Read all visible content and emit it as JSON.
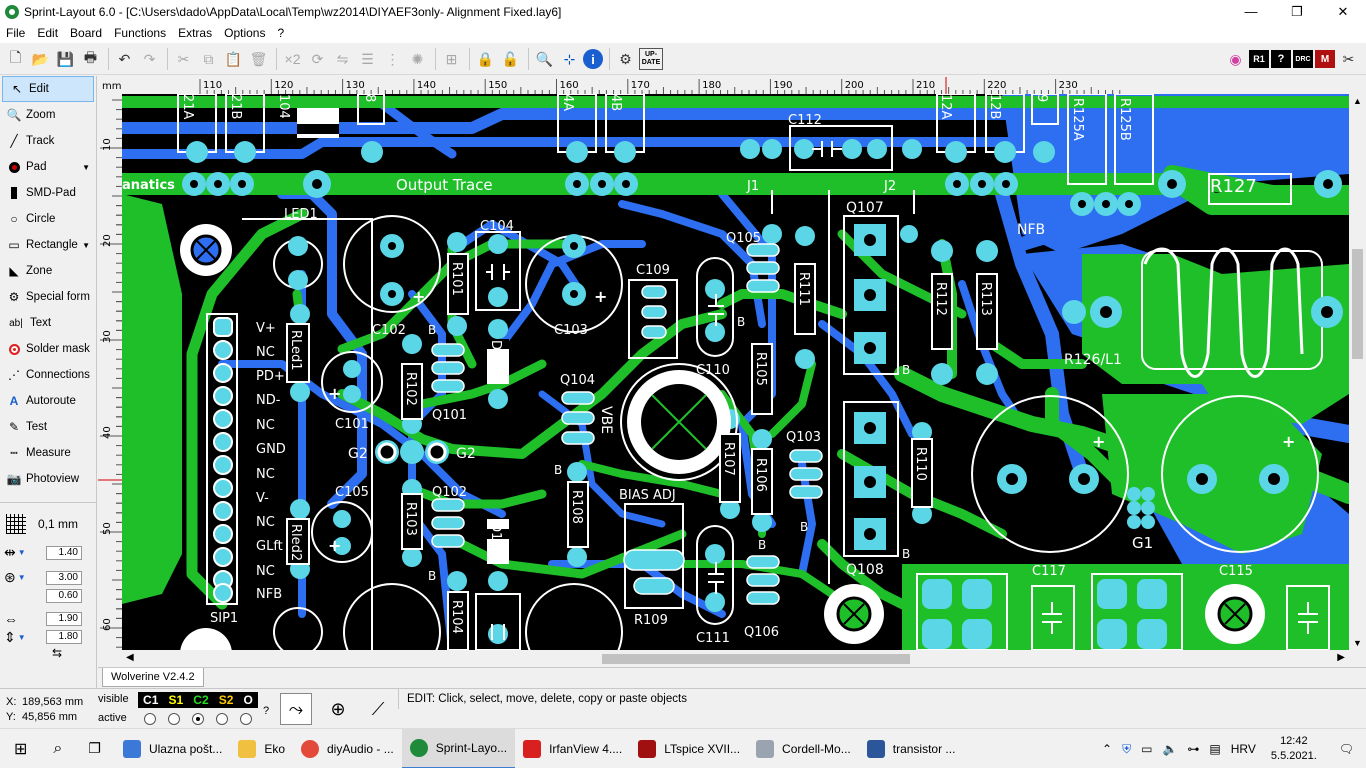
{
  "window": {
    "title": "Sprint-Layout 6.0 - [C:\\Users\\dado\\AppData\\Local\\Temp\\wz2014\\DIYAEF3only- Alignment Fixed.lay6]",
    "minimize": "—",
    "maximize": "❐",
    "close": "✕"
  },
  "menu": [
    "File",
    "Edit",
    "Board",
    "Functions",
    "Extras",
    "Options",
    "?"
  ],
  "toolbar": {
    "x2_label": "×2",
    "update_label": "UP-DATE",
    "r1_label": "R1",
    "drc_label": "DRC",
    "m_label": "M"
  },
  "tools": [
    {
      "label": "Edit",
      "icon": "cursor-arrow-icon"
    },
    {
      "label": "Zoom",
      "icon": "magnifier-icon"
    },
    {
      "label": "Track",
      "icon": "track-icon"
    },
    {
      "label": "Pad",
      "icon": "pad-icon"
    },
    {
      "label": "SMD-Pad",
      "icon": "smd-pad-icon"
    },
    {
      "label": "Circle",
      "icon": "circle-icon"
    },
    {
      "label": "Rectangle",
      "icon": "rectangle-icon"
    },
    {
      "label": "Zone",
      "icon": "zone-icon"
    },
    {
      "label": "Special form",
      "icon": "special-form-icon"
    },
    {
      "label": "Text",
      "icon": "text-tool-icon"
    },
    {
      "label": "Solder mask",
      "icon": "solder-mask-icon"
    },
    {
      "label": "Connections",
      "icon": "connections-icon"
    },
    {
      "label": "Autoroute",
      "icon": "autoroute-icon"
    },
    {
      "label": "Test",
      "icon": "test-icon"
    },
    {
      "label": "Measure",
      "icon": "measure-icon"
    },
    {
      "label": "Photoview",
      "icon": "photoview-icon"
    }
  ],
  "grid": {
    "value": "0,1 mm"
  },
  "params": {
    "track_width": "1.40",
    "pad_outer": "3.00",
    "pad_inner": "0.60",
    "smd_w": "1.90",
    "smd_h": "1.80"
  },
  "ruler": {
    "unit": "mm",
    "top_labels": [
      "110",
      "120",
      "130",
      "140",
      "150",
      "160",
      "170",
      "180",
      "190",
      "200",
      "210",
      "220",
      "230"
    ],
    "left_labels": [
      "10",
      "20",
      "30",
      "40",
      "50",
      "60"
    ]
  },
  "board": {
    "colors": {
      "background": "#000000",
      "copper_top": "#1fbf2a",
      "copper_bottom": "#2d6ff0",
      "pad": "#5bd6e6",
      "silk": "#ffffff"
    },
    "labels": {
      "output_trace": "Output Trace",
      "anatics": "anatics",
      "led1": "LED1",
      "c104": "C104",
      "c102": "C102",
      "c103": "C103",
      "c101": "C101",
      "c105": "C105",
      "c109": "C109",
      "c110": "C110",
      "c111": "C111",
      "c112": "C112",
      "c115": "C115",
      "c117": "C117",
      "q101": "Q101",
      "q102": "Q102",
      "q103": "Q103",
      "q104": "Q104",
      "q105": "Q105",
      "q106": "Q106",
      "q107": "Q107",
      "q108": "Q108",
      "r101": "R101",
      "r102": "R102",
      "r103": "R103",
      "r104": "R104",
      "r105": "R105",
      "r106": "R106",
      "r107": "R107",
      "r108": "R108",
      "r109": "R109",
      "r110": "R110",
      "r111": "R111",
      "r112": "R112",
      "r113": "R113",
      "r127": "R127",
      "r126l1": "R126/L1",
      "r125a": "R125A",
      "r125b": "R125B",
      "rled1": "RLed1",
      "rled2": "Rled2",
      "d101": "D101",
      "d102": "D102",
      "j1": "J1",
      "j2": "J2",
      "nfb": "NFB",
      "g1": "G1",
      "g2a": "G2",
      "g2b": "G2",
      "vbe": "VBE",
      "bias_adj": "BIAS ADJ",
      "sip1": "SIP1",
      "b": "B",
      "plus": "+",
      "top_frag1": "21A",
      "top_frag2": "21B",
      "top_frag3": "104",
      "top_frag4": "8",
      "top_frag5": "4A",
      "top_frag6": "4B",
      "top_frag7": "12A",
      "top_frag8": "12B",
      "top_frag9": "9",
      "sip_pins": [
        "V+",
        "NC",
        "PD+",
        "ND-",
        "NC",
        "GND",
        "NC",
        "V-",
        "NC",
        "GLft",
        "NC",
        "NFB"
      ]
    }
  },
  "tab": {
    "label": "Wolverine V2.4.2"
  },
  "status": {
    "x_label": "X:",
    "x_value": "189,563 mm",
    "y_label": "Y:",
    "y_value": "45,856 mm",
    "visible_label": "visible",
    "active_label": "active",
    "layers": [
      "C1",
      "S1",
      "C2",
      "S2",
      "O"
    ],
    "layer_colors": [
      "#ffffff",
      "#ffff00",
      "#22dd22",
      "#ffcc00",
      "#ffffff"
    ],
    "active_layer_index": 2,
    "question": "?",
    "message": "EDIT:  Click, select, move, delete, copy or paste objects"
  },
  "taskbar": {
    "items": [
      {
        "label": "Ulazna pošt...",
        "color": "#3b78d8"
      },
      {
        "label": "Eko",
        "color": "#f0c040"
      },
      {
        "label": "diyAudio - ...",
        "color": "#e44a3a"
      },
      {
        "label": "Sprint-Layo...",
        "color": "#1e8a3a"
      },
      {
        "label": "IrfanView 4....",
        "color": "#d82020"
      },
      {
        "label": "LTspice XVII...",
        "color": "#a01010"
      },
      {
        "label": "Cordell-Mo...",
        "color": "#9aa4b0"
      },
      {
        "label": "transistor ...",
        "color": "#2b579a"
      }
    ],
    "active_index": 3,
    "lang": "HRV",
    "time": "12:42",
    "date": "5.5.2021."
  }
}
